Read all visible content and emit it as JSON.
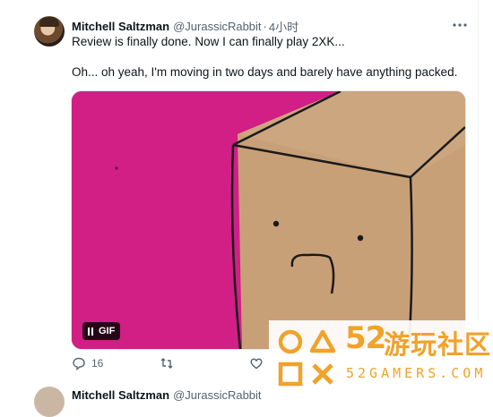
{
  "tweet": {
    "author_name": "Mitchell Saltzman",
    "author_handle": "@JurassicRabbit",
    "separator": "·",
    "timestamp": "4小时",
    "text_line1": "Review is finally done. Now I can finally play 2XK...",
    "text_line2": "Oh... oh yeah, I'm moving in two days and barely have anything packed.",
    "media": {
      "badge": "GIF",
      "bg_color": "#d11f86",
      "box_color": "#c8a078"
    },
    "actions": {
      "reply_count": "16",
      "retweet_count": "",
      "like_count": ""
    }
  },
  "next_tweet": {
    "author_name": "Mitchell Saltzman",
    "author_handle": "@JurassicRabbit"
  },
  "watermark": {
    "site_name_number": "52",
    "site_name_cn": "游玩社区",
    "site_url": "52GAMERS.COM",
    "color": "#f0a22a"
  }
}
